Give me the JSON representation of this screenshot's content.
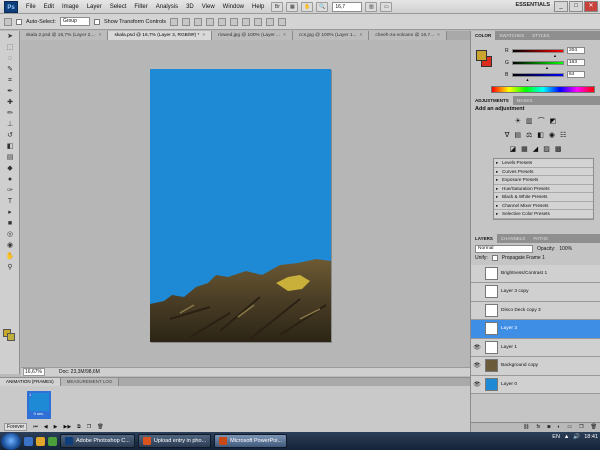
{
  "app": {
    "logo": "Ps",
    "menu": [
      "File",
      "Edit",
      "Image",
      "Layer",
      "Select",
      "Filter",
      "Analysis",
      "3D",
      "View",
      "Window",
      "Help"
    ],
    "zoom": "16,7",
    "workspace": "ESSENTIALS",
    "win_min": "_",
    "win_max": "□",
    "win_close": "✕"
  },
  "options": {
    "auto_select_label": "Auto-Select:",
    "auto_select_value": "Group",
    "transform_label": "Show Transform Controls"
  },
  "tabs": [
    {
      "label": "skala 2.psd @ 16,7% (Layer 2,..."
    },
    {
      "label": "skala.psd @ 16,7% (Layer 3, RGB/8#) *"
    },
    {
      "label": "riowed.jpg @ 100% (Layer ..."
    },
    {
      "label": "ccs.jpg @ 100% (Layer 1..."
    },
    {
      "label": "cheeh-za-volcano @ 16,7..."
    }
  ],
  "status": {
    "zoom": "16,67%",
    "doc": "Doc: 23,3M/98,6M"
  },
  "animation": {
    "tabs": [
      "ANIMATION (FRAMES)",
      "MEASUREMENT LOG"
    ],
    "frame_number": "1",
    "frame_delay": "0 sec.",
    "loop": "Forever"
  },
  "color_panel": {
    "tabs": [
      "COLOR",
      "SWATCHES",
      "STYLES"
    ],
    "sliders": [
      {
        "label": "R",
        "value": "204",
        "color": "#ff0000",
        "level": 0.8
      },
      {
        "label": "G",
        "value": "163",
        "color": "#00ff00",
        "level": 0.64
      },
      {
        "label": "B",
        "value": "64",
        "color": "#0000ff",
        "level": 0.25
      }
    ],
    "foreground": "#c9a52d",
    "background": "#dd2b1c"
  },
  "adjustments": {
    "tabs": [
      "ADJUSTMENTS",
      "MASKS"
    ],
    "title": "Add an adjustment",
    "presets": [
      "Levels Presets",
      "Curves Presets",
      "Exposure Presets",
      "Hue/Saturation Presets",
      "Black & White Presets",
      "Channel Mixer Presets",
      "Selective Color Presets"
    ]
  },
  "layers_panel": {
    "tabs": [
      "LAYERS",
      "CHANNELS",
      "PATHS"
    ],
    "blend_mode": "Normal",
    "opacity_label": "Opacity:",
    "opacity_value": "100%",
    "unify_label": "Unify:",
    "propagate_label": "Propagate Frame 1",
    "lock_label": "Lock:",
    "fill_label": "Fill:",
    "fill_value": "100%",
    "layers": [
      {
        "name": "Brightness/Contrast 1",
        "visible": false,
        "thumb": "white",
        "selected": false
      },
      {
        "name": "Layer 3 copy",
        "visible": false,
        "thumb": "white",
        "selected": false
      },
      {
        "name": "Disco Deck copy 3",
        "visible": false,
        "thumb": "white",
        "selected": false
      },
      {
        "name": "Layer 3",
        "visible": false,
        "thumb": "white",
        "selected": true
      },
      {
        "name": "Layer 1",
        "visible": true,
        "thumb": "white",
        "selected": false
      },
      {
        "name": "Background copy",
        "visible": true,
        "thumb": "rock",
        "selected": false
      },
      {
        "name": "Layer 0",
        "visible": true,
        "thumb": "blue",
        "selected": false
      }
    ]
  },
  "taskbar": {
    "tasks": [
      {
        "label": "Adobe Photoshop C...",
        "icon_color": "#0f3e7c",
        "active": false
      },
      {
        "label": "Upload entry in pho...",
        "icon_color": "#d9541e",
        "active": false
      },
      {
        "label": "Microsoft PowerPoi...",
        "icon_color": "#c84a16",
        "active": true
      }
    ],
    "lang": "EN",
    "time": "18:41"
  }
}
